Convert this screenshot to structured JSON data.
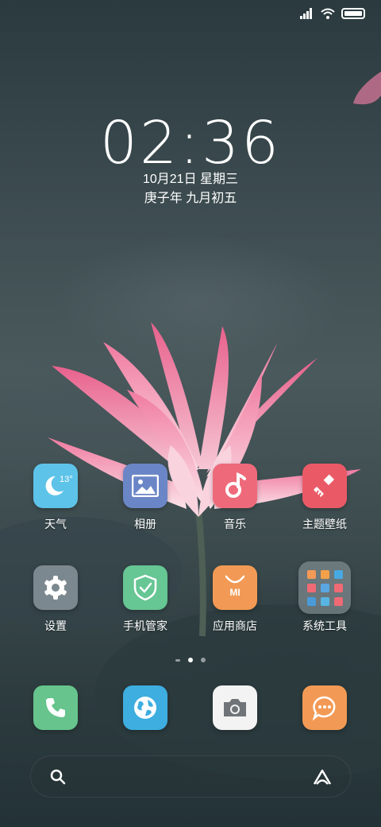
{
  "status_bar": {
    "icons": [
      "signal-icon",
      "wifi-icon",
      "battery-icon"
    ],
    "battery_level": 1.0
  },
  "clock": {
    "time": "02:36",
    "date": "10月21日 星期三",
    "lunar": "庚子年 九月初五"
  },
  "apps": [
    {
      "name": "weather",
      "label": "天气",
      "icon": "weather-moon-icon",
      "color": "#5ec3e8",
      "temp": "13°"
    },
    {
      "name": "gallery",
      "label": "相册",
      "icon": "gallery-icon",
      "color": "#6b86c6"
    },
    {
      "name": "music",
      "label": "音乐",
      "icon": "music-note-icon",
      "color": "#ee6a7a"
    },
    {
      "name": "themes",
      "label": "主题壁纸",
      "icon": "paintbrush-icon",
      "color": "#ea5a66"
    },
    {
      "name": "settings",
      "label": "设置",
      "icon": "gear-icon",
      "color": "#7c888f"
    },
    {
      "name": "security",
      "label": "手机管家",
      "icon": "shield-check-icon",
      "color": "#66c694"
    },
    {
      "name": "app-store",
      "label": "应用商店",
      "icon": "shopping-bag-icon",
      "color": "#f29a55",
      "badge_text": "MI"
    },
    {
      "name": "tools-folder",
      "label": "系统工具",
      "icon": "folder-icon"
    }
  ],
  "dock": [
    {
      "name": "phone",
      "icon": "phone-icon",
      "color": "#66c48c"
    },
    {
      "name": "browser",
      "icon": "globe-icon",
      "color": "#3eaee0"
    },
    {
      "name": "camera",
      "icon": "camera-icon",
      "color": "#f3f3f3"
    },
    {
      "name": "messages",
      "icon": "chat-bubble-icon",
      "color": "#f29a55"
    }
  ],
  "pager": {
    "pages": 2,
    "active": 1
  },
  "search": {
    "left_icon": "search-icon",
    "right_icon": "assistant-icon"
  }
}
